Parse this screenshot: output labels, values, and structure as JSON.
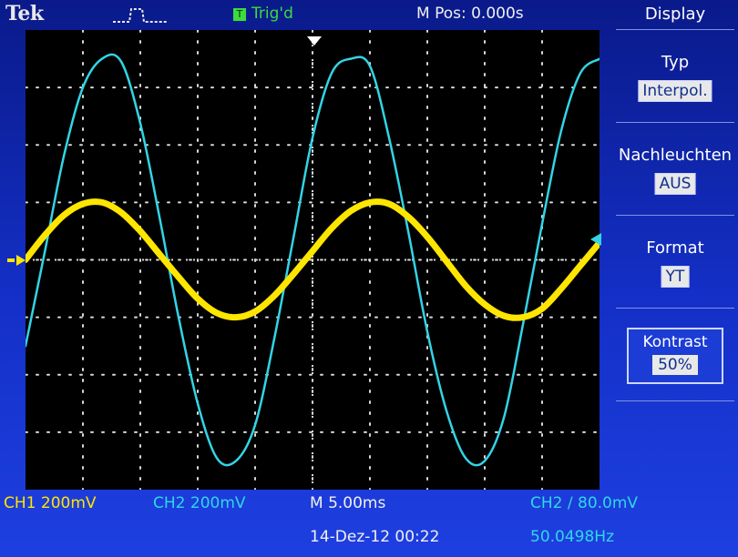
{
  "header": {
    "brand": "Tek",
    "trigger_status": "Trig'd",
    "trigger_icon": "T",
    "main_position": "M Pos: 0.000s"
  },
  "menu": {
    "title": "Display",
    "items": [
      {
        "label": "Typ",
        "value": "Interpol."
      },
      {
        "label": "Nachleuchten",
        "value": "AUS"
      },
      {
        "label": "Format",
        "value": "YT"
      },
      {
        "label": "Kontrast",
        "value": "50%"
      }
    ]
  },
  "footer": {
    "ch1": "CH1  200mV",
    "ch2": "CH2  200mV",
    "timebase": "M 5.00ms",
    "trigger": "CH2 ∕ 80.0mV",
    "datetime": "14-Dez-12 00:22",
    "frequency": "50.0498Hz"
  },
  "colors": {
    "ch1": "#ffe600",
    "ch2": "#33d4e6",
    "grid": "#d8d8d8",
    "background": "#000000",
    "panel": "#1430c8"
  },
  "chart_data": {
    "type": "line",
    "series": [
      {
        "name": "CH1",
        "values": [
          0.0,
          0.17,
          0.31,
          0.39,
          0.4,
          0.33,
          0.2,
          0.04,
          -0.12,
          -0.27,
          -0.37,
          -0.4,
          -0.36,
          -0.25,
          -0.1,
          0.06,
          0.22,
          0.34,
          0.4,
          0.39,
          0.3,
          0.16,
          -0.01,
          -0.18,
          -0.31,
          -0.39,
          -0.4,
          -0.34,
          -0.2,
          -0.04,
          0.12
        ]
      },
      {
        "name": "CH2",
        "values": [
          -0.6,
          0.05,
          0.72,
          1.2,
          1.4,
          1.38,
          0.95,
          0.3,
          -0.4,
          -1.0,
          -1.38,
          -1.4,
          -1.15,
          -0.55,
          0.15,
          0.85,
          1.3,
          1.4,
          1.35,
          0.85,
          0.2,
          -0.5,
          -1.05,
          -1.38,
          -1.4,
          -1.1,
          -0.45,
          0.25,
          0.9,
          1.3,
          1.4
        ]
      }
    ],
    "timebase": "5.00ms/div",
    "divisions_x": 10,
    "divisions_y": 8,
    "ylim": [
      -1.6,
      1.6
    ],
    "grid": true
  }
}
